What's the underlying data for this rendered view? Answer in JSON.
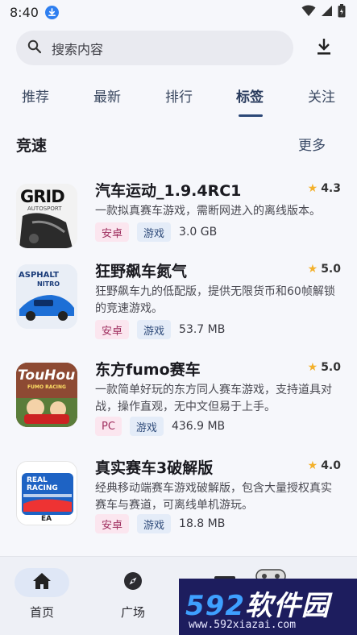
{
  "status_bar": {
    "time": "8:40"
  },
  "search": {
    "placeholder": "搜索内容"
  },
  "tabs": [
    {
      "label": "推荐"
    },
    {
      "label": "最新"
    },
    {
      "label": "排行"
    },
    {
      "label": "标签",
      "active": true
    },
    {
      "label": "关注"
    }
  ],
  "section": {
    "title": "竞速",
    "more": "更多"
  },
  "apps": [
    {
      "name": "汽车运动_1.9.4RC1",
      "rating": "4.3",
      "desc": "一款拟真赛车游戏，需断网进入的离线版本。",
      "platform": "安卓",
      "type": "游戏",
      "size": "3.0 GB",
      "icon_text": "GRID",
      "icon_subtext": "AUTOSPORT"
    },
    {
      "name": "狂野飙车氮气",
      "rating": "5.0",
      "desc": "狂野飙车九的低配版，提供无限货币和60帧解锁的竞速游戏。",
      "platform": "安卓",
      "type": "游戏",
      "size": "53.7 MB",
      "icon_text": "ASPHALT",
      "icon_subtext": "NITRO"
    },
    {
      "name": "东方fumo赛车",
      "rating": "5.0",
      "desc": "一款简单好玩的东方同人赛车游戏，支持道具对战，操作直观，无中文但易于上手。",
      "platform": "PC",
      "type": "游戏",
      "size": "436.9 MB",
      "icon_text": "TouHou",
      "icon_subtext": "FUMO RACING"
    },
    {
      "name": "真实赛车3破解版",
      "rating": "4.0",
      "desc": "经典移动端赛车游戏破解版，包含大量授权真实赛车与赛道，可离线单机游玩。",
      "platform": "安卓",
      "type": "游戏",
      "size": "18.8 MB",
      "icon_text": "REAL RACING",
      "icon_subtext": "EA"
    }
  ],
  "bottom_nav": [
    {
      "label": "首页",
      "icon": "home-icon",
      "active": true
    },
    {
      "label": "广场",
      "icon": "compass-icon"
    }
  ],
  "watermark": {
    "brand_num": "592",
    "brand_text": "软件园",
    "url": "www.592xiazai.com"
  },
  "colors": {
    "accent": "#2c4877",
    "star": "#f3b12c",
    "chip_platform_bg": "#fbe6ef",
    "chip_type_bg": "#e4ecf8"
  }
}
